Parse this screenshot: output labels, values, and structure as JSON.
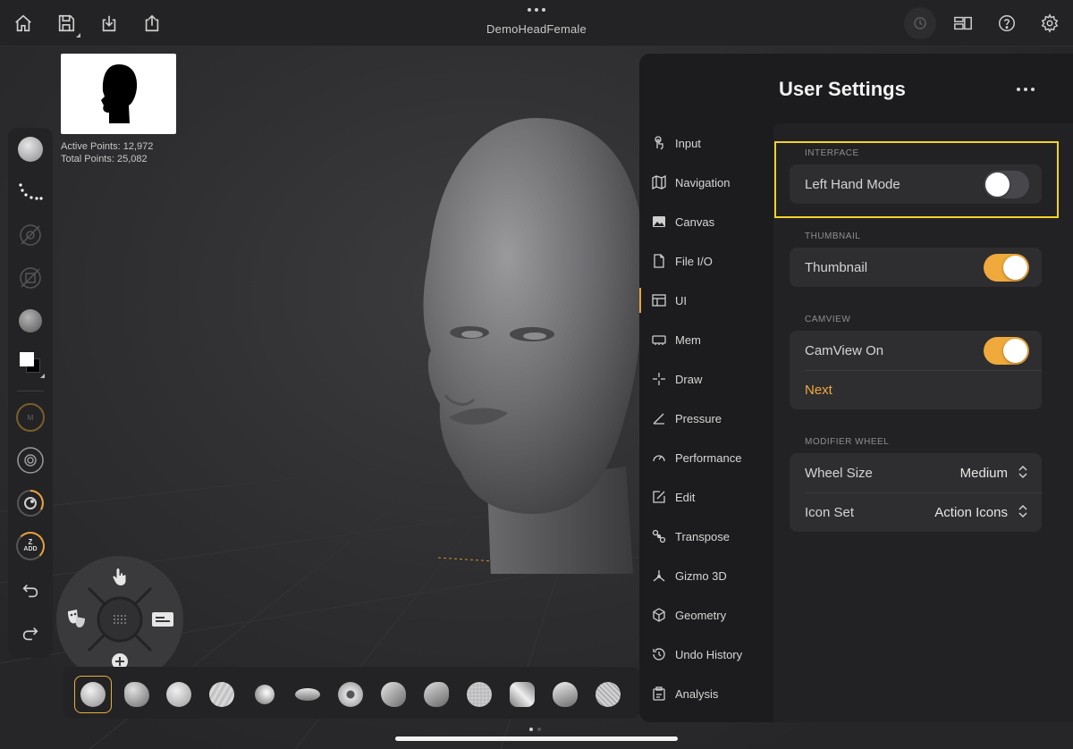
{
  "app": {
    "document_title": "DemoHeadFemale"
  },
  "topbar": {
    "left_icons": [
      "home-icon",
      "save-icon",
      "import-icon",
      "share-icon"
    ],
    "right_icons": [
      "history-icon",
      "layout-icon",
      "help-icon",
      "gear-icon"
    ]
  },
  "viewport": {
    "active_points": "Active Points: 12,972",
    "total_points": "Total Points: 25,082"
  },
  "left_toolbar": {
    "z_add_line1": "Z",
    "z_add_line2": "ADD",
    "m_label": "M"
  },
  "settings": {
    "title": "User Settings",
    "nav": [
      {
        "label": "Input",
        "icon": "touch-icon"
      },
      {
        "label": "Navigation",
        "icon": "map-icon"
      },
      {
        "label": "Canvas",
        "icon": "image-icon"
      },
      {
        "label": "File I/O",
        "icon": "file-icon"
      },
      {
        "label": "UI",
        "icon": "layout-icon",
        "active": true
      },
      {
        "label": "Mem",
        "icon": "memory-icon"
      },
      {
        "label": "Draw",
        "icon": "crosshair-icon"
      },
      {
        "label": "Pressure",
        "icon": "pressure-icon"
      },
      {
        "label": "Performance",
        "icon": "gauge-icon"
      },
      {
        "label": "Edit",
        "icon": "edit-icon"
      },
      {
        "label": "Transpose",
        "icon": "transpose-icon"
      },
      {
        "label": "Gizmo 3D",
        "icon": "gizmo-icon"
      },
      {
        "label": "Geometry",
        "icon": "cube-icon"
      },
      {
        "label": "Undo History",
        "icon": "history-icon"
      },
      {
        "label": "Analysis",
        "icon": "clipboard-icon"
      }
    ],
    "sections": {
      "interface": {
        "header": "INTERFACE",
        "left_hand_mode": {
          "label": "Left Hand Mode",
          "on": false
        }
      },
      "thumbnail": {
        "header": "THUMBNAIL",
        "thumbnail": {
          "label": "Thumbnail",
          "on": true
        }
      },
      "camview": {
        "header": "CAMVIEW",
        "camview_on": {
          "label": "CamView On",
          "on": true
        },
        "next": "Next"
      },
      "modifier_wheel": {
        "header": "MODIFIER WHEEL",
        "wheel_size": {
          "label": "Wheel Size",
          "value": "Medium"
        },
        "icon_set": {
          "label": "Icon Set",
          "value": "Action Icons"
        }
      }
    }
  },
  "colors": {
    "accent": "#f0a93b",
    "highlight": "#f3d22a",
    "panel": "#222224",
    "group": "#2e2e31"
  }
}
